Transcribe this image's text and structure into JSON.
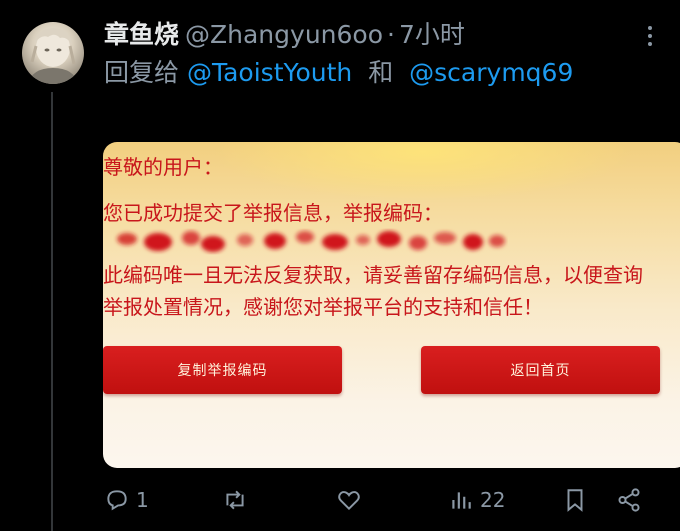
{
  "tweet": {
    "display_name": "章鱼烧",
    "handle": "@Zhangyun6oo",
    "separator": "·",
    "time": "7小时",
    "reply_prefix": "回复给",
    "reply_mentions": [
      "@TaoistYouth",
      "@scarymq69"
    ],
    "reply_join": "和"
  },
  "card": {
    "greeting": "尊敬的用户：",
    "submitted_line": "您已成功提交了举报信息，举报编码：",
    "notice": "此编码唯一且无法反复获取，请妥善留存编码信息，以便查询举报处置情况，感谢您对举报平台的支持和信任！",
    "copy_button": "复制举报编码",
    "home_button": "返回首页",
    "text_color": "#c8161b",
    "button_color": "#c8161b"
  },
  "actions": {
    "reply_count": "1",
    "retweet_count": "",
    "like_count": "",
    "views_count": "22"
  },
  "colors": {
    "background": "#000000",
    "muted": "#8b98a5",
    "link": "#1d9bf0"
  },
  "icons": [
    "more-icon",
    "reply-icon",
    "retweet-icon",
    "like-icon",
    "views-icon",
    "bookmark-icon",
    "share-icon"
  ]
}
